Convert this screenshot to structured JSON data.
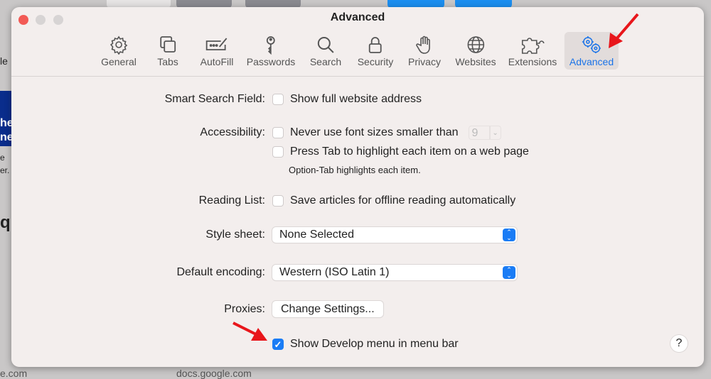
{
  "background": {
    "left_text_1": "le",
    "left_text_2": "he",
    "left_text_3": "ne",
    "left_text_4": "e",
    "left_text_5": "er.",
    "left_text_6": "qu",
    "bottom_left": "e.com",
    "bottom_mid": "docs.google.com"
  },
  "window": {
    "title": "Advanced"
  },
  "toolbar": {
    "items": [
      {
        "label": "General",
        "icon": "gear-icon"
      },
      {
        "label": "Tabs",
        "icon": "tabs-icon"
      },
      {
        "label": "AutoFill",
        "icon": "autofill-icon"
      },
      {
        "label": "Passwords",
        "icon": "key-icon"
      },
      {
        "label": "Search",
        "icon": "search-icon"
      },
      {
        "label": "Security",
        "icon": "lock-icon"
      },
      {
        "label": "Privacy",
        "icon": "hand-icon"
      },
      {
        "label": "Websites",
        "icon": "globe-icon"
      },
      {
        "label": "Extensions",
        "icon": "puzzle-icon"
      },
      {
        "label": "Advanced",
        "icon": "gears-icon",
        "selected": true
      }
    ]
  },
  "settings": {
    "smart_search": {
      "label": "Smart Search Field:",
      "option": "Show full website address",
      "checked": false
    },
    "accessibility": {
      "label": "Accessibility:",
      "font_option": "Never use font sizes smaller than",
      "font_size": "9",
      "font_checked": false,
      "tab_option": "Press Tab to highlight each item on a web page",
      "tab_checked": false,
      "tab_note": "Option-Tab highlights each item."
    },
    "reading_list": {
      "label": "Reading List:",
      "option": "Save articles for offline reading automatically",
      "checked": false
    },
    "style_sheet": {
      "label": "Style sheet:",
      "value": "None Selected"
    },
    "encoding": {
      "label": "Default encoding:",
      "value": "Western (ISO Latin 1)"
    },
    "proxies": {
      "label": "Proxies:",
      "button": "Change Settings..."
    },
    "develop": {
      "option": "Show Develop menu in menu bar",
      "checked": true
    }
  },
  "help": "?",
  "colors": {
    "accent": "#1a7cf5",
    "annotation": "#e8161b",
    "window_bg": "#f3eeed"
  }
}
